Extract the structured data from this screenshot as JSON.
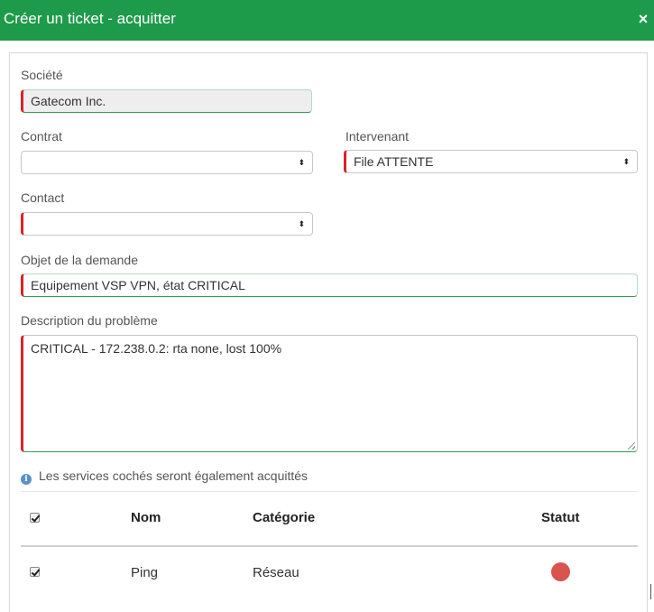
{
  "dialog": {
    "title": "Créer un ticket - acquitter",
    "close_glyph": "×"
  },
  "form": {
    "societe": {
      "label": "Société",
      "value": "Gatecom Inc."
    },
    "contrat": {
      "label": "Contrat",
      "value": ""
    },
    "intervenant": {
      "label": "Intervenant",
      "value": "File ATTENTE"
    },
    "contact": {
      "label": "Contact",
      "value": ""
    },
    "objet": {
      "label": "Objet de la demande",
      "value": "Equipement VSP VPN, état CRITICAL"
    },
    "description": {
      "label": "Description du problème",
      "value": "CRITICAL - 172.238.0.2: rta none, lost 100%"
    }
  },
  "info": {
    "icon": "info-icon",
    "icon_glyph": "i",
    "text": "Les services cochés seront également acquittés"
  },
  "services_table": {
    "headers": {
      "nom": "Nom",
      "categorie": "Catégorie",
      "statut": "Statut"
    },
    "select_all_checked": true,
    "rows": [
      {
        "checked": true,
        "nom": "Ping",
        "categorie": "Réseau",
        "statut": "critical",
        "statut_color": "#d9534f"
      }
    ]
  },
  "colors": {
    "titlebar": "#1e9a4b",
    "required_marker": "#d9222a",
    "valid_underline": "#2e9e55",
    "info_icon": "#5b8fc7"
  },
  "select_arrow_glyph": "⬍"
}
